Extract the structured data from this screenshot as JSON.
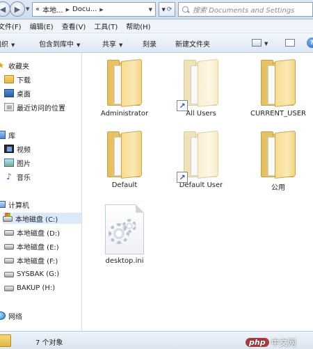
{
  "address_bar": {
    "breadcrumb": [
      "«",
      "本地...",
      "Docu..."
    ],
    "search_placeholder": "搜索 Documents and Settings"
  },
  "menu": [
    "文件(F)",
    "编辑(E)",
    "查看(V)",
    "工具(T)",
    "帮助(H)"
  ],
  "commands": {
    "organize": "组织",
    "include_library": "包含到库中",
    "share": "共享",
    "burn": "刻录",
    "new_folder": "新建文件夹"
  },
  "nav": {
    "favorites": "收藏夹",
    "downloads": "下载",
    "desktop": "桌面",
    "recent": "最近访问的位置",
    "libraries": "库",
    "videos": "视频",
    "pictures": "图片",
    "music": "音乐",
    "computer": "计算机",
    "drives": [
      "本地磁盘 (C:)",
      "本地磁盘 (D:)",
      "本地磁盘 (E:)",
      "本地磁盘 (F:)",
      "SYSBAK (G:)",
      "BAKUP (H:)"
    ],
    "network": "网络"
  },
  "files": [
    "Administrator",
    "All Users",
    "CURRENT_USER",
    "Default",
    "Default User",
    "公用",
    "desktop.ini"
  ],
  "status": "7 个对象",
  "watermark": {
    "brand": "php",
    "site": "中文网"
  },
  "colors": {
    "folder": "#f0d58b",
    "selection": "#dbe9f9",
    "chrome": "#dde8f5"
  }
}
